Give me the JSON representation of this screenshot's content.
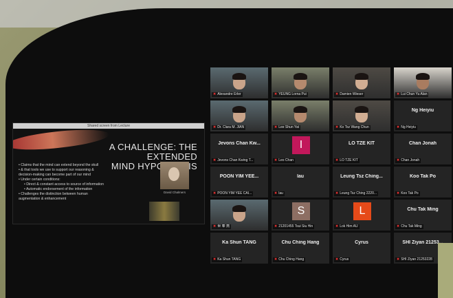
{
  "slide": {
    "window_title": "Shared screen from Lecture",
    "title_line1": "A CHALLENGE: THE EXTENDED",
    "title_line2": "MIND HYPOTHESIS",
    "bullets": [
      {
        "text": "• Claims that the mind can extend beyond the skull",
        "level": 1
      },
      {
        "text": "• & that tools we use to support our reasoning &",
        "level": 1
      },
      {
        "text": "  decision-making can become part of our mind",
        "level": 1
      },
      {
        "text": "• Under certain conditions:",
        "level": 1
      },
      {
        "text": "• Direct & constant access to source of information",
        "level": 2
      },
      {
        "text": "• Automatic endorsement of the information",
        "level": 2
      },
      {
        "text": "• Challenges the distinction between human",
        "level": 1
      },
      {
        "text": "  augmentation & enhancement",
        "level": 1
      }
    ],
    "photo_caption": "David Chalmers"
  },
  "participants": [
    {
      "name": "",
      "label": "Alexandre Erler",
      "type": "video",
      "active": true
    },
    {
      "name": "",
      "label": "YEUNG Lorna Pui",
      "type": "video"
    },
    {
      "name": "",
      "label": "Damien Wieser",
      "type": "video"
    },
    {
      "name": "",
      "label": "Lui Chun Yu Alan",
      "type": "video"
    },
    {
      "name": "",
      "label": "Dr. Clara M. JIAN",
      "type": "video"
    },
    {
      "name": "",
      "label": "Lee Shun Yat",
      "type": "video"
    },
    {
      "name": "",
      "label": "Ko Tsz Wang Chun",
      "type": "video"
    },
    {
      "name": "Ng Heiyiu",
      "label": "Ng Heiyiu",
      "type": "name"
    },
    {
      "name": "Jevons Chan Kw...",
      "label": "Jevons Chan Kwing T...",
      "type": "name"
    },
    {
      "name": "",
      "label": "Leo Chan",
      "type": "avatar",
      "avatar_letter": "I",
      "avatar_color": "#c2185b"
    },
    {
      "name": "LO TZE KIT",
      "label": "LO TZE KIT",
      "type": "name"
    },
    {
      "name": "Chan Jonah",
      "label": "Chan Jonah",
      "type": "name"
    },
    {
      "name": "POON YIM YEE...",
      "label": "POON YIM YEE CAI...",
      "type": "name"
    },
    {
      "name": "lau",
      "label": "lau",
      "type": "name"
    },
    {
      "name": "Leung Tsz Ching...",
      "label": "Leung Tsz Ching 2220...",
      "type": "name"
    },
    {
      "name": "Koo Tak Po",
      "label": "Koo Tak Po",
      "type": "name"
    },
    {
      "name": "",
      "label": "世 奉 燕",
      "type": "video"
    },
    {
      "name": "",
      "label": "21201455 Tsui Siu Hin",
      "type": "avatar",
      "avatar_letter": "S",
      "avatar_color": "#8d6e63"
    },
    {
      "name": "",
      "label": "Lok Him AU",
      "type": "avatar",
      "avatar_letter": "L",
      "avatar_color": "#e64a19"
    },
    {
      "name": "Chu Tak Ming",
      "label": "Chu Tak Ming",
      "type": "name"
    },
    {
      "name": "Ka Shun TANG",
      "label": "Ka Shun TANG",
      "type": "name"
    },
    {
      "name": "Chu Ching Hang",
      "label": "Chu Ching Hang",
      "type": "name"
    },
    {
      "name": "Cyrus",
      "label": "Cyrus",
      "type": "name"
    },
    {
      "name": "SHI Ziyan 21253...",
      "label": "SHI Ziyan 21253228",
      "type": "name"
    }
  ],
  "colors": {
    "accent_active": "#c9b53c",
    "muted_mic": "#e23030"
  }
}
